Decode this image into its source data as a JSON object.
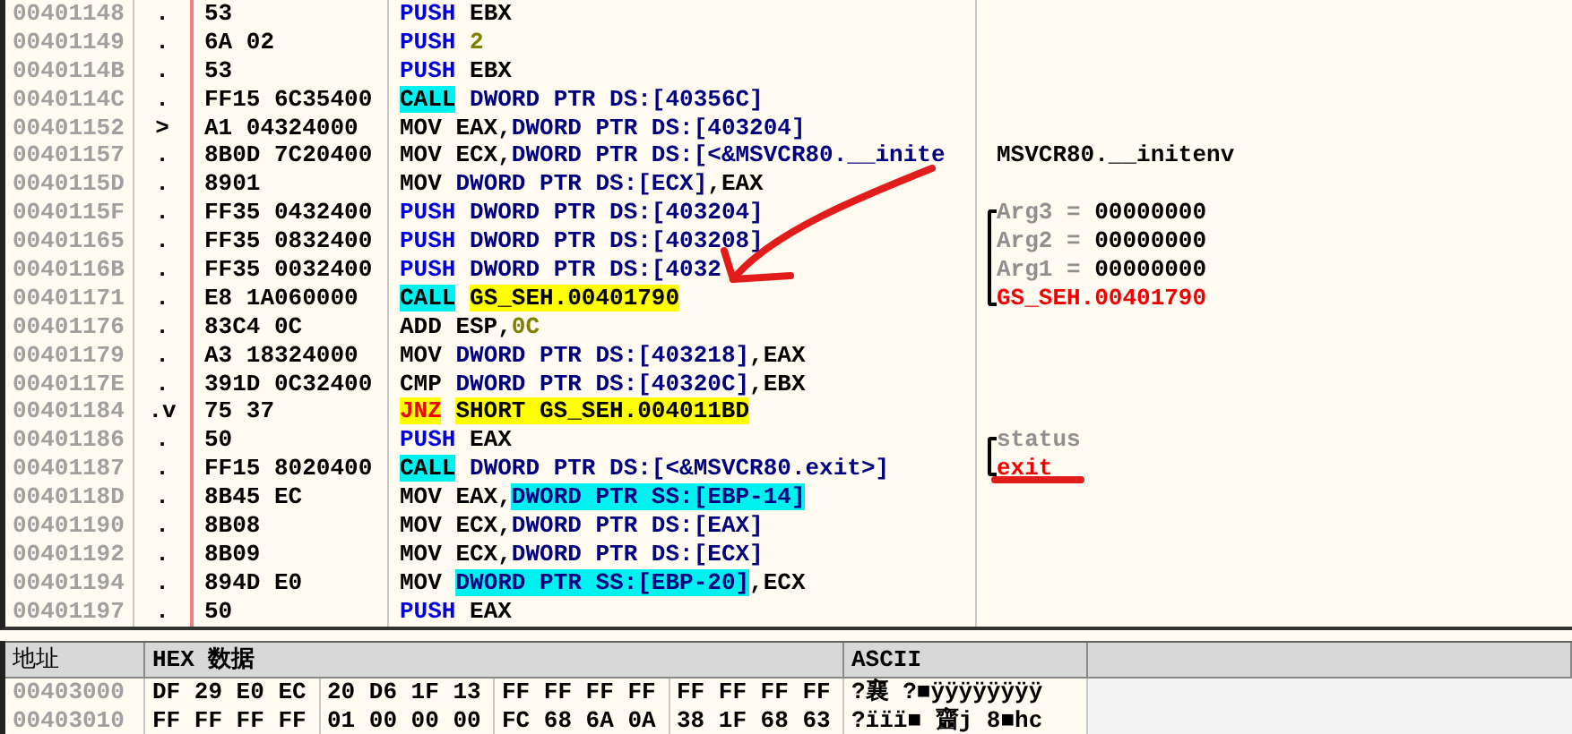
{
  "disassembly": {
    "rows": [
      {
        "address": "00401148",
        "marker": ".",
        "hex": "53",
        "tokens": [
          {
            "text": "PUSH",
            "kind": "push"
          },
          {
            "text": " EBX",
            "kind": "reg"
          }
        ]
      },
      {
        "address": "00401149",
        "marker": ".",
        "hex": "6A 02",
        "tokens": [
          {
            "text": "PUSH",
            "kind": "push"
          },
          {
            "text": " 2",
            "kind": "imm"
          }
        ]
      },
      {
        "address": "0040114B",
        "marker": ".",
        "hex": "53",
        "tokens": [
          {
            "text": "PUSH",
            "kind": "push"
          },
          {
            "text": " EBX",
            "kind": "reg"
          }
        ]
      },
      {
        "address": "0040114C",
        "marker": ".",
        "hex": "FF15 6C35400",
        "tokens": [
          {
            "text": "CALL",
            "kind": "call"
          },
          {
            "text": " DWORD PTR DS:[40356C]",
            "kind": "mem"
          }
        ]
      },
      {
        "address": "00401152",
        "marker": ">",
        "hex": "A1 04324000",
        "tokens": [
          {
            "text": "MOV EAX,",
            "kind": "reg"
          },
          {
            "text": "DWORD PTR DS:[403204]",
            "kind": "mem"
          }
        ]
      },
      {
        "address": "00401157",
        "marker": ".",
        "hex": "8B0D 7C20400",
        "tokens": [
          {
            "text": "MOV ECX,",
            "kind": "reg"
          },
          {
            "text": "DWORD PTR DS:[<&MSVCR80.__inite",
            "kind": "mem"
          }
        ],
        "comment": {
          "kind": "plain",
          "tokens": [
            {
              "text": "MSVCR80.__initenv",
              "kind": "plain"
            }
          ]
        }
      },
      {
        "address": "0040115D",
        "marker": ".",
        "hex": "8901",
        "tokens": [
          {
            "text": "MOV ",
            "kind": "reg"
          },
          {
            "text": "DWORD PTR DS:[ECX]",
            "kind": "mem"
          },
          {
            "text": ",EAX",
            "kind": "reg"
          }
        ]
      },
      {
        "address": "0040115F",
        "marker": ".",
        "hex": "FF35 0432400",
        "tokens": [
          {
            "text": "PUSH",
            "kind": "push"
          },
          {
            "text": " DWORD PTR DS:[403204]",
            "kind": "mem"
          }
        ],
        "comment": {
          "kind": "bracket-top",
          "tokens": [
            {
              "text": "Arg3 = ",
              "kind": "dim"
            },
            {
              "text": "00000000",
              "kind": "plain"
            }
          ]
        }
      },
      {
        "address": "00401165",
        "marker": ".",
        "hex": "FF35 0832400",
        "tokens": [
          {
            "text": "PUSH",
            "kind": "push"
          },
          {
            "text": " DWORD PTR DS:[403208]",
            "kind": "mem"
          }
        ],
        "comment": {
          "kind": "bracket-middle",
          "tokens": [
            {
              "text": "Arg2 = ",
              "kind": "dim"
            },
            {
              "text": "00000000",
              "kind": "plain"
            }
          ]
        }
      },
      {
        "address": "0040116B",
        "marker": ".",
        "hex": "FF35 0032400",
        "tokens": [
          {
            "text": "PUSH",
            "kind": "push"
          },
          {
            "text": " DWORD PTR DS:[4032",
            "kind": "mem"
          }
        ],
        "comment": {
          "kind": "bracket-middle",
          "tokens": [
            {
              "text": "Arg1 = ",
              "kind": "dim"
            },
            {
              "text": "00000000",
              "kind": "plain"
            }
          ]
        }
      },
      {
        "address": "00401171",
        "marker": ".",
        "hex": "E8 1A060000",
        "tokens": [
          {
            "text": "CALL",
            "kind": "call"
          },
          {
            "text": "GS_SEH.00401790",
            "kind": "target"
          }
        ],
        "comment": {
          "kind": "bracket-bottom",
          "tokens": [
            {
              "text": "GS_SEH.00401790",
              "kind": "alert"
            }
          ]
        }
      },
      {
        "address": "00401176",
        "marker": ".",
        "hex": "83C4 0C",
        "tokens": [
          {
            "text": "ADD ESP,",
            "kind": "reg"
          },
          {
            "text": "0C",
            "kind": "imm"
          }
        ]
      },
      {
        "address": "00401179",
        "marker": ".",
        "hex": "A3 18324000",
        "tokens": [
          {
            "text": "MOV ",
            "kind": "reg"
          },
          {
            "text": "DWORD PTR DS:[403218]",
            "kind": "mem"
          },
          {
            "text": ",EAX",
            "kind": "reg"
          }
        ]
      },
      {
        "address": "0040117E",
        "marker": ".",
        "hex": "391D 0C32400",
        "tokens": [
          {
            "text": "CMP ",
            "kind": "reg"
          },
          {
            "text": "DWORD PTR DS:[40320C]",
            "kind": "mem"
          },
          {
            "text": ",EBX",
            "kind": "reg"
          }
        ]
      },
      {
        "address": "00401184",
        "marker": ".v",
        "hex": "75 37",
        "tokens": [
          {
            "text": "JNZ",
            "kind": "jump"
          },
          {
            "text": "SHORT GS_SEH.004011BD",
            "kind": "target"
          }
        ]
      },
      {
        "address": "00401186",
        "marker": ".",
        "hex": "50",
        "tokens": [
          {
            "text": "PUSH",
            "kind": "push"
          },
          {
            "text": " EAX",
            "kind": "reg"
          }
        ],
        "comment": {
          "kind": "bracket-top",
          "tokens": [
            {
              "text": "status",
              "kind": "dim"
            }
          ]
        }
      },
      {
        "address": "00401187",
        "marker": ".",
        "hex": "FF15 8020400",
        "tokens": [
          {
            "text": "CALL",
            "kind": "call"
          },
          {
            "text": " DWORD PTR DS:[<&MSVCR80.exit>]",
            "kind": "mem"
          }
        ],
        "comment": {
          "kind": "bracket-bottom",
          "underlined": true,
          "tokens": [
            {
              "text": "exit",
              "kind": "alert"
            }
          ]
        }
      },
      {
        "address": "0040118D",
        "marker": ".",
        "hex": "8B45 EC",
        "tokens": [
          {
            "text": "MOV EAX,",
            "kind": "reg"
          },
          {
            "text": "DWORD PTR SS:[EBP-14]",
            "kind": "stack"
          }
        ]
      },
      {
        "address": "00401190",
        "marker": ".",
        "hex": "8B08",
        "tokens": [
          {
            "text": "MOV ECX,",
            "kind": "reg"
          },
          {
            "text": "DWORD PTR DS:[EAX]",
            "kind": "mem"
          }
        ]
      },
      {
        "address": "00401192",
        "marker": ".",
        "hex": "8B09",
        "tokens": [
          {
            "text": "MOV ECX,",
            "kind": "reg"
          },
          {
            "text": "DWORD PTR DS:[ECX]",
            "kind": "mem"
          }
        ]
      },
      {
        "address": "00401194",
        "marker": ".",
        "hex": "894D E0",
        "tokens": [
          {
            "text": "MOV ",
            "kind": "reg"
          },
          {
            "text": "DWORD PTR SS:[EBP-20]",
            "kind": "stack"
          },
          {
            "text": ",ECX",
            "kind": "reg"
          }
        ]
      },
      {
        "address": "00401197",
        "marker": ".",
        "hex": "50",
        "tokens": [
          {
            "text": "PUSH",
            "kind": "push"
          },
          {
            "text": " EAX",
            "kind": "reg"
          }
        ]
      }
    ]
  },
  "annotations": [
    {
      "kind": "arrow"
    }
  ],
  "dump": {
    "columns": [
      "地址",
      "HEX 数据",
      "ASCII"
    ],
    "rows": [
      {
        "address": "00403000",
        "groups": [
          "DF 29 E0 EC",
          "20 D6 1F 13",
          "FF FF FF FF",
          "FF FF FF FF"
        ],
        "ascii": "?襄 ?■ÿÿÿÿÿÿÿÿ"
      },
      {
        "address": "00403010",
        "groups": [
          "FF FF FF FF",
          "01 00 00 00",
          "FC 68 6A 0A",
          "38 1F 68 63"
        ],
        "ascii": "?ïïï■   齏j 8■hc"
      }
    ]
  }
}
